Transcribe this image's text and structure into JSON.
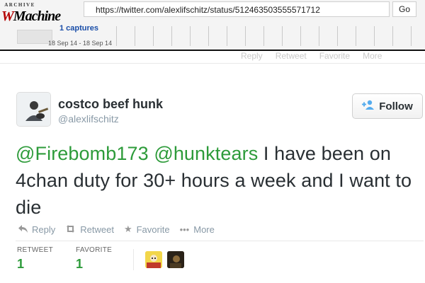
{
  "wayback": {
    "logo_top": "ARCHIVE",
    "logo_main_a": "W",
    "logo_main_b": "Machine",
    "url": "https://twitter.com/alexlifschitz/status/512463503555571712",
    "go_label": "Go",
    "captures": "1 captures",
    "date_range": "18 Sep 14 - 18 Sep 14"
  },
  "faded_actions": [
    "Reply",
    "Retweet",
    "Favorite",
    "More"
  ],
  "tweet": {
    "display_name": "costco beef hunk",
    "screen_name": "@alexlifschitz",
    "follow_label": "Follow",
    "mention1": "@Firebomb173",
    "mention2": "@hunktears",
    "body": " I have been on 4chan duty for 30+ hours a week and I want to die",
    "actions": {
      "reply": "Reply",
      "retweet": "Retweet",
      "favorite": "Favorite",
      "more": "More"
    },
    "stats": {
      "retweet_label": "RETWEET",
      "retweet_count": "1",
      "favorite_label": "FAVORITE",
      "favorite_count": "1"
    }
  },
  "colors": {
    "link_green": "#2d9b3a",
    "follow_icon_blue": "#55acee",
    "muted_text": "#8899a6"
  }
}
